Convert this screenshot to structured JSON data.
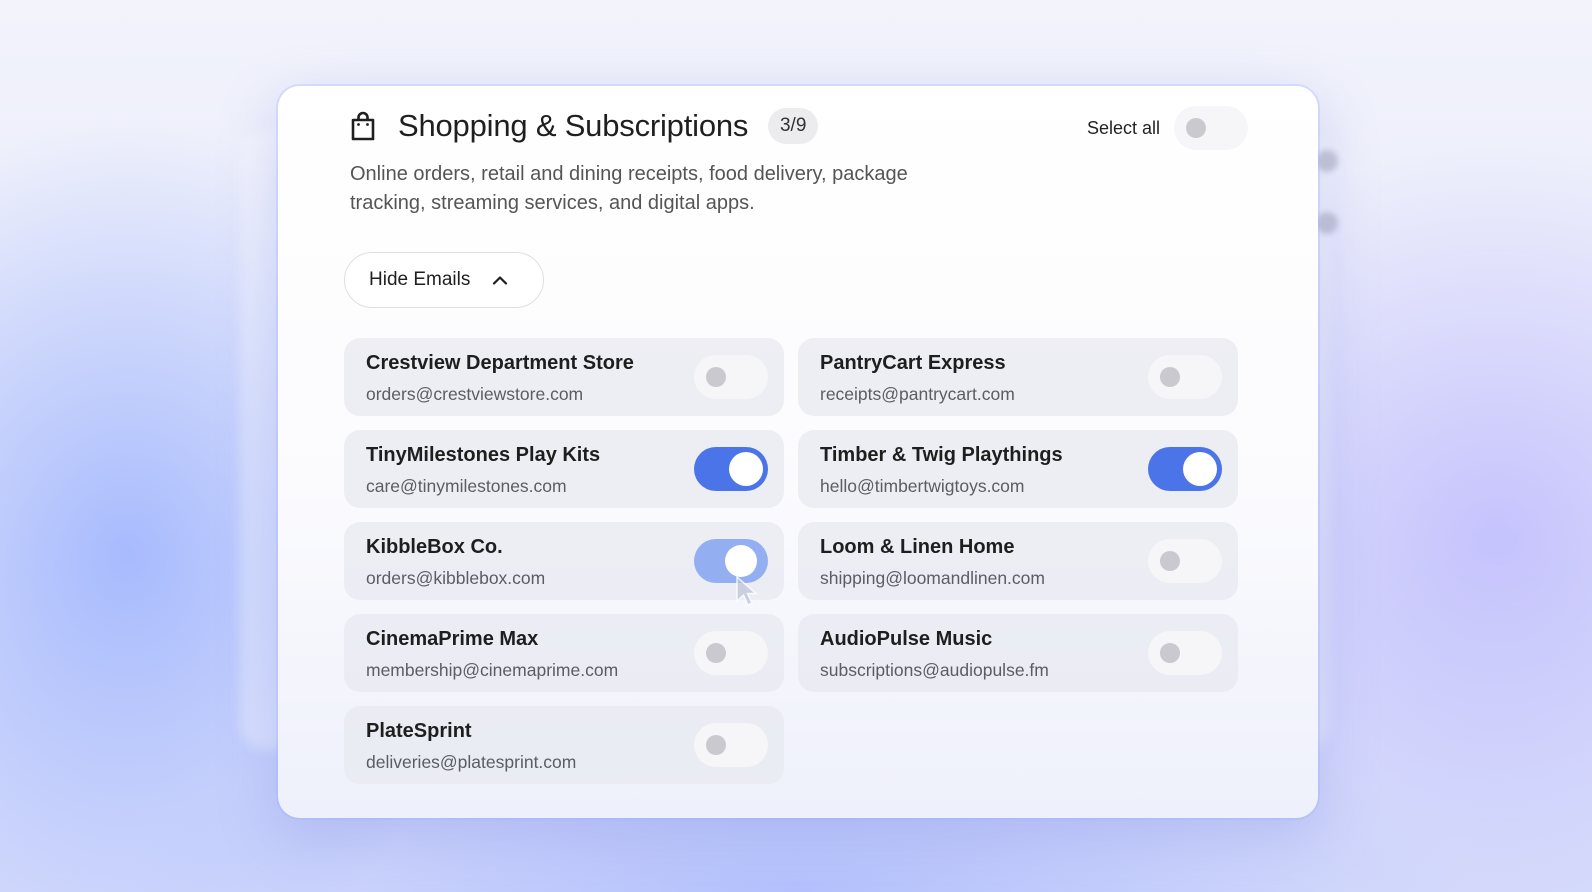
{
  "header": {
    "icon": "shopping-bag-icon",
    "title": "Shopping & Subscriptions",
    "count_badge": "3/9",
    "description": "Online orders, retail and dining receipts, food delivery, package tracking, streaming services, and digital apps.",
    "select_all_label": "Select all",
    "select_all_on": false
  },
  "hide_button": {
    "label": "Hide Emails",
    "icon": "chevron-up-icon"
  },
  "senders": [
    {
      "name": "Crestview Department Store",
      "email": "orders@crestviewstore.com",
      "enabled": false
    },
    {
      "name": "PantryCart Express",
      "email": "receipts@pantrycart.com",
      "enabled": false
    },
    {
      "name": "TinyMilestones Play Kits",
      "email": "care@tinymilestones.com",
      "enabled": true
    },
    {
      "name": "Timber & Twig Playthings",
      "email": "hello@timbertwigtoys.com",
      "enabled": true
    },
    {
      "name": "KibbleBox Co.",
      "email": "orders@kibblebox.com",
      "enabled": true
    },
    {
      "name": "Loom & Linen Home",
      "email": "shipping@loomandlinen.com",
      "enabled": false
    },
    {
      "name": "CinemaPrime Max",
      "email": "membership@cinemaprime.com",
      "enabled": false
    },
    {
      "name": "AudioPulse Music",
      "email": "subscriptions@audiopulse.fm",
      "enabled": false
    },
    {
      "name": "PlateSprint",
      "email": "deliveries@platesprint.com",
      "enabled": false
    }
  ],
  "colors": {
    "accent": "#4a74e8",
    "accent_transitioning": "#94aef2"
  }
}
